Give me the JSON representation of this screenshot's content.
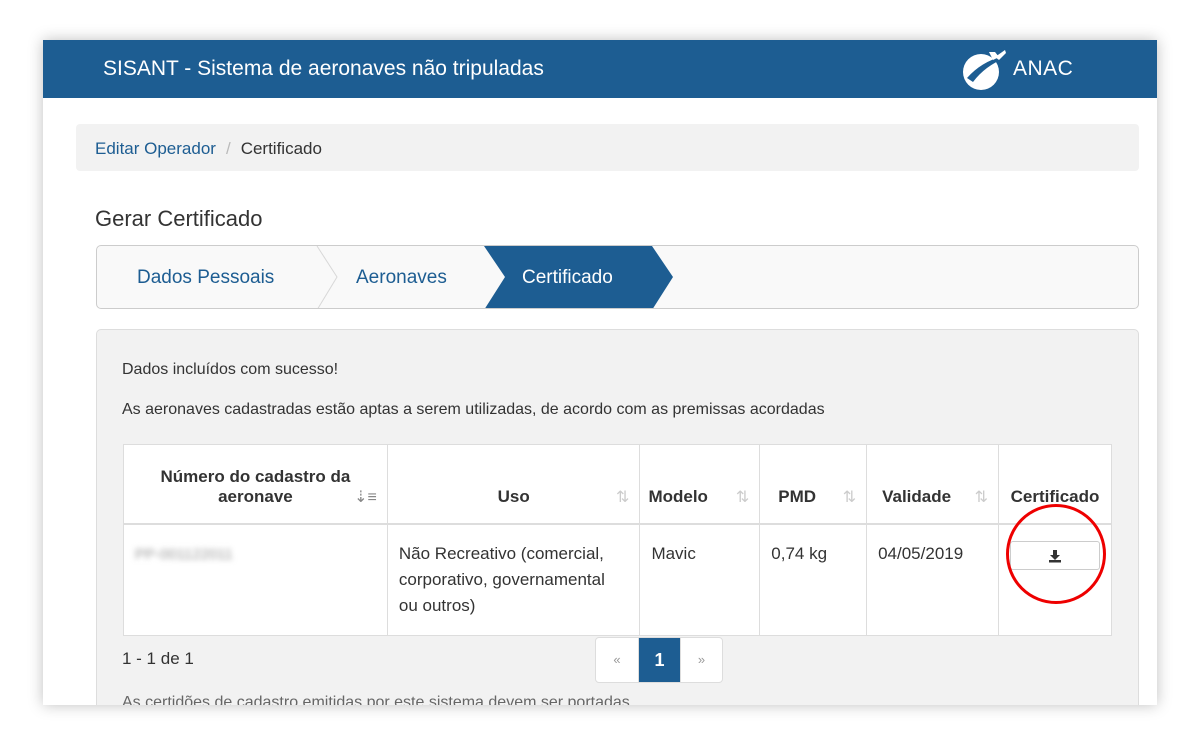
{
  "app": {
    "title": "SISANT - Sistema de aeronaves não tripuladas",
    "logo_text": "ANAC",
    "brand_color": "#1d5d92"
  },
  "breadcrumb": {
    "link": "Editar Operador",
    "separator": "/",
    "current": "Certificado"
  },
  "section_title": "Gerar Certificado",
  "steps": [
    {
      "label": "Dados Pessoais",
      "active": false
    },
    {
      "label": "Aeronaves",
      "active": false
    },
    {
      "label": "Certificado",
      "active": true
    }
  ],
  "messages": {
    "success": "Dados incluídos com sucesso!",
    "info": "As aeronaves cadastradas estão aptas a serem utilizadas, de acordo com as premissas acordadas"
  },
  "table": {
    "columns": [
      {
        "label": "Número do cadastro da aeronave",
        "sort_icon": "sort-numeric-icon"
      },
      {
        "label": "Uso",
        "sort_icon": "sort-icon"
      },
      {
        "label": "Modelo",
        "sort_icon": "sort-icon"
      },
      {
        "label": "PMD",
        "sort_icon": "sort-icon"
      },
      {
        "label": "Validade",
        "sort_icon": "sort-icon"
      },
      {
        "label": "Certificado"
      }
    ],
    "rows": [
      {
        "numero": "PP-001122011",
        "uso": "Não Recreativo (comercial, corporativo, governamental ou outros)",
        "modelo": "Mavic",
        "pmd": "0,74 kg",
        "validade": "04/05/2019",
        "certificado_icon": "download-icon"
      }
    ]
  },
  "pagination": {
    "summary": "1 - 1 de 1",
    "prev": "«",
    "current": "1",
    "next": "»"
  },
  "footnote": "As certidões de cadastro emitidas por este sistema devem ser portadas",
  "annotation": {
    "circle_color": "#e00000"
  }
}
